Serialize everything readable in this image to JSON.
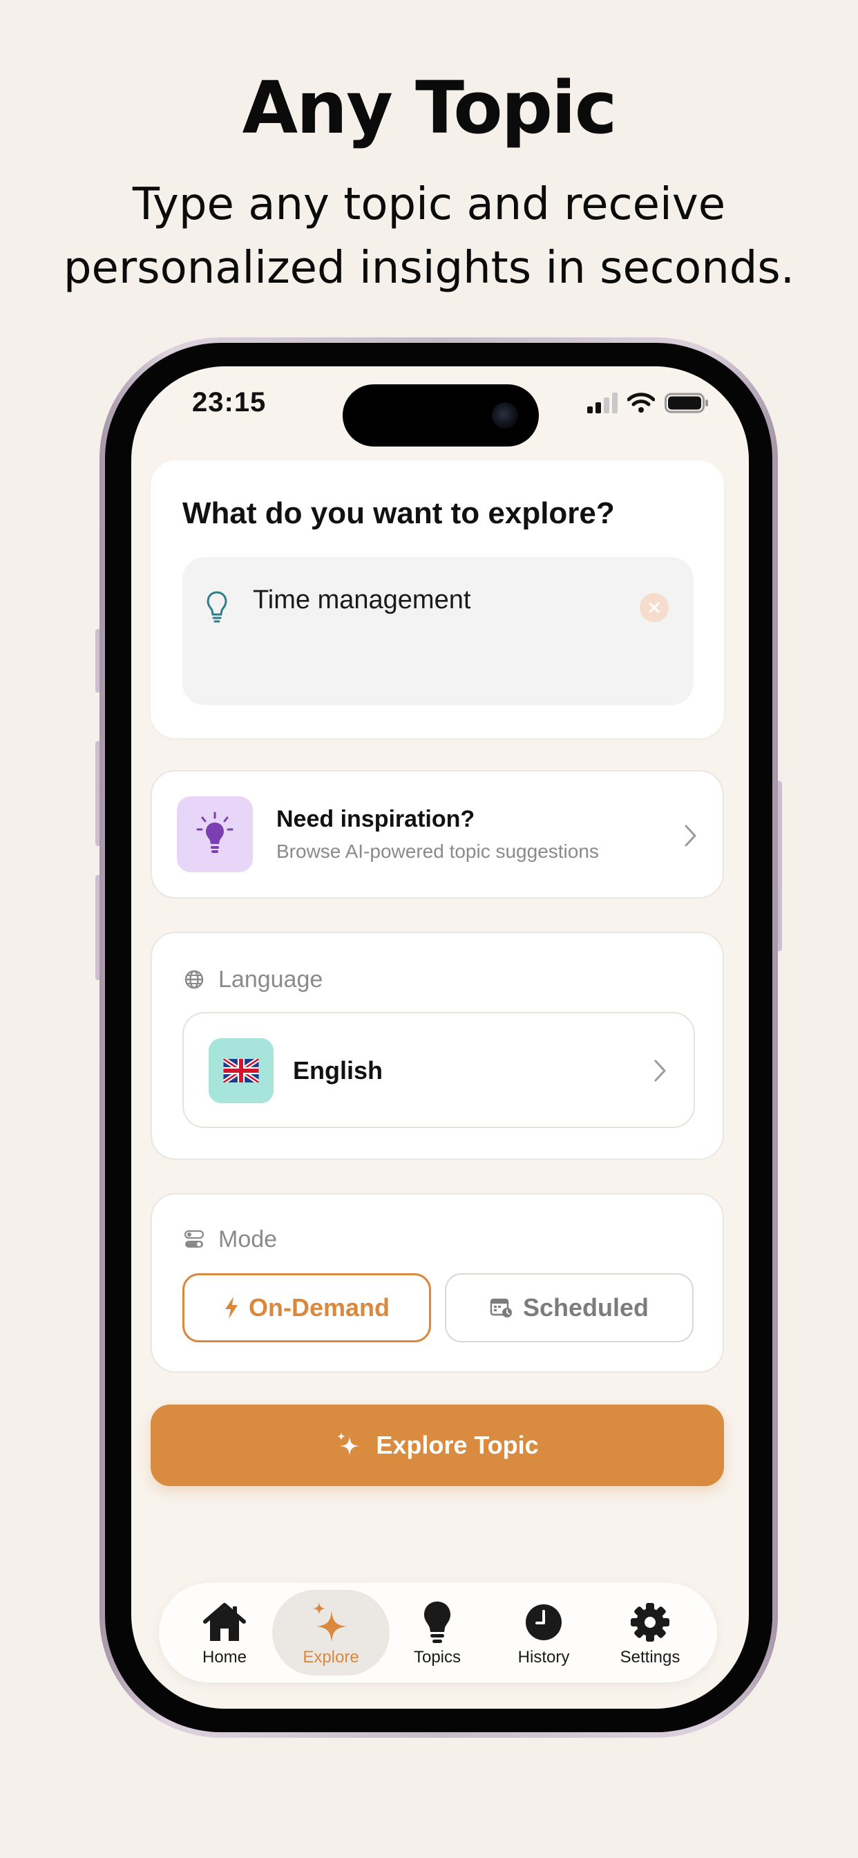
{
  "hero": {
    "title": "Any Topic",
    "subtitle_line1": "Type any topic and receive",
    "subtitle_line2": "personalized insights in seconds."
  },
  "status_bar": {
    "time": "23:15"
  },
  "explore_card": {
    "title": "What do you want to explore?",
    "topic_value": "Time management"
  },
  "inspiration": {
    "title": "Need inspiration?",
    "subtitle": "Browse AI-powered topic suggestions"
  },
  "language": {
    "label": "Language",
    "selected": "English",
    "flag": "🇬🇧"
  },
  "mode": {
    "label": "Mode",
    "options": [
      {
        "label": "On-Demand",
        "selected": true
      },
      {
        "label": "Scheduled",
        "selected": false
      }
    ]
  },
  "cta": {
    "label": "Explore Topic"
  },
  "tabbar": {
    "items": [
      {
        "label": "Home",
        "icon": "house-icon"
      },
      {
        "label": "Explore",
        "icon": "sparkles-icon",
        "active": true
      },
      {
        "label": "Topics",
        "icon": "lightbulb-icon"
      },
      {
        "label": "History",
        "icon": "clock-icon"
      },
      {
        "label": "Settings",
        "icon": "gear-icon"
      }
    ]
  },
  "colors": {
    "accent": "#d9883e",
    "cta": "#d98c40",
    "background": "#f5f0ea",
    "inspiration_bg": "#e7d6f7",
    "flag_bg": "#a6e4dc"
  }
}
